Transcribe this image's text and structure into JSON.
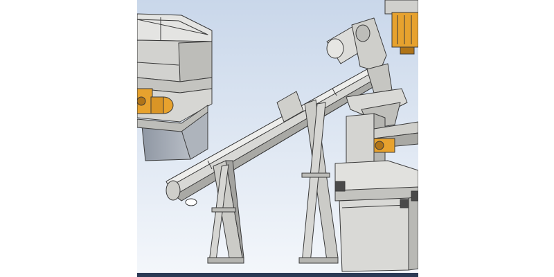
{
  "scene": {
    "viewport_bg_top": "#c9d7ea",
    "viewport_bg_bottom": "#f4f7fb",
    "steel_light": "#e2e2e0",
    "steel_mid": "#c7c7c4",
    "steel_dark": "#9a9a96",
    "steel_shadow": "#7f8894",
    "motor_orange": "#e7a22e",
    "motor_orange_dark": "#b07418",
    "outline": "#3a3a3a"
  },
  "taskbar": {
    "color": "#2b3a55"
  }
}
